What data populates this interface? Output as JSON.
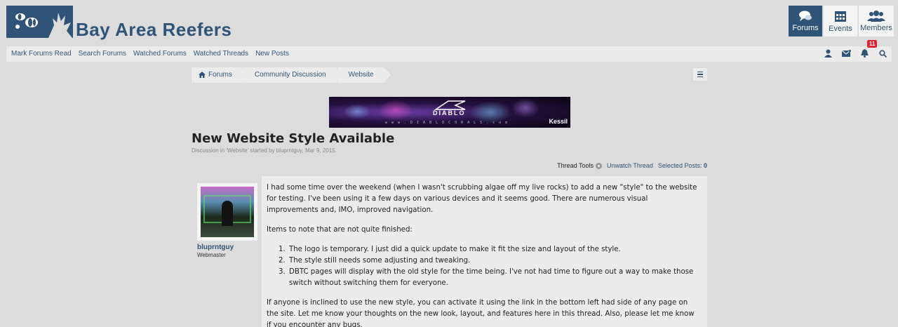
{
  "site": {
    "title": "Bay Area Reefers"
  },
  "top_nav": {
    "forums": "Forums",
    "events": "Events",
    "members": "Members"
  },
  "subnav": {
    "links": [
      "Mark Forums Read",
      "Search Forums",
      "Watched Forums",
      "Watched Threads",
      "New Posts"
    ],
    "alert_count": "11"
  },
  "breadcrumb": [
    "Forums",
    "Community Discussion",
    "Website"
  ],
  "banner": {
    "brand": "DIABLO",
    "url": "www.DIABLOCORALS.com",
    "sponsor": "Kessil"
  },
  "thread": {
    "title": "New Website Style Available",
    "meta": "Discussion in 'Website' started by bluprntguy, Mar 9, 2015.",
    "tools_label": "Thread Tools",
    "unwatch_label": "Unwatch Thread",
    "selected_posts_label": "Selected Posts:",
    "selected_posts_count": "0"
  },
  "post": {
    "username": "bluprntguy",
    "user_title": "Webmaster",
    "p1": "I had some time over the weekend (when I wasn't scrubbing algae off my live rocks) to add a new \"style\" to the website for testing. I've been using it a few days on various devices and it seems good. There are numerous visual improvements and, IMO, improved navigation.",
    "p2": "Items to note that are not quite finished:",
    "items": [
      "The logo is temporary. I just did a quick update to make it fit the size and layout of the style.",
      "The style still needs some adjusting and tweaking.",
      "DBTC pages will display with the old style for the time being. I've not had time to figure out a way to make those switch without switching them for everyone."
    ],
    "p3": "If anyone is inclined to use the new style, you can activate it using the link in the bottom left had side of any page on the site. Let me know your thoughts on the new look, layout, and features here in this thread. Also, please let me know if you encounter any bugs."
  },
  "colors": {
    "brand": "#2f5477",
    "background": "#dcdcdc",
    "panel": "#ececec",
    "alert": "#dd2233"
  },
  "icons": [
    "clownfish-logo-icon",
    "chat-bubbles-icon",
    "calendar-icon",
    "users-icon",
    "user-icon",
    "envelope-icon",
    "bell-icon",
    "search-icon",
    "home-icon",
    "gear-icon",
    "hamburger-menu-icon"
  ]
}
